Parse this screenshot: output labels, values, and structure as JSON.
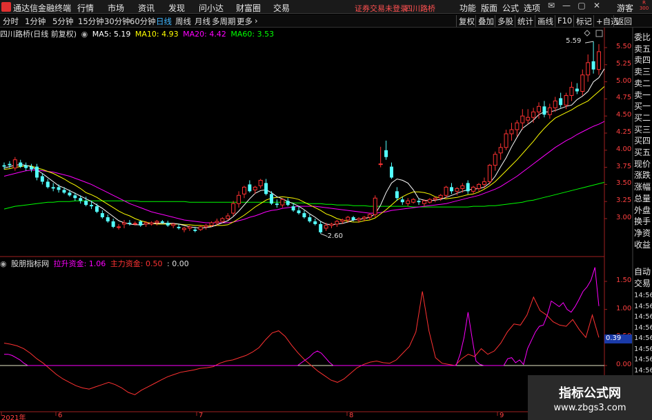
{
  "app": {
    "title": "通达信金融终端"
  },
  "menu": [
    "行情",
    "市场",
    "资讯",
    "发现",
    "问小达",
    "财富圈",
    "交易"
  ],
  "notice": "证券交易未登录",
  "stock_name_top": "四川路桥",
  "right_menu": [
    "功能",
    "版面",
    "公式",
    "选项"
  ],
  "guest": "游客",
  "badge_line1": "R",
  "badge_line2": "300",
  "periods": [
    {
      "label": "分时"
    },
    {
      "label": "1分钟"
    },
    {
      "label": "5分钟"
    },
    {
      "label": "15分钟"
    },
    {
      "label": "30分钟"
    },
    {
      "label": "60分钟"
    },
    {
      "label": "日线"
    },
    {
      "label": "周线"
    },
    {
      "label": "月线"
    },
    {
      "label": "多周期"
    },
    {
      "label": "更多"
    }
  ],
  "toolbar_right": [
    "复权",
    "叠加",
    "多股",
    "统计",
    "画线",
    "F10",
    "标记",
    "+自选",
    "返回"
  ],
  "main": {
    "title": "四川路桥(日线 前复权)",
    "ma5": "MA5: 5.19",
    "ma10": "MA10: 4.93",
    "ma20": "MA20: 4.42",
    "ma60": "MA60: 3.53",
    "high_label": "5.59",
    "low_label": "2.60",
    "y_ticks": [
      "5.50",
      "5.25",
      "5.00",
      "4.75",
      "4.50",
      "4.25",
      "4.00",
      "3.75",
      "3.50",
      "3.25",
      "3.00"
    ],
    "colors": {
      "ma5": "#ffffff",
      "ma10": "#ffff00",
      "ma20": "#ff00ff",
      "ma60": "#00ff00",
      "up": "#ff3232",
      "down": "#54ffff"
    }
  },
  "sub": {
    "title": "股朋指标网",
    "lashen": "拉升资金: 1.06",
    "zhuli": "主力资金: 0.50",
    "zero": ": 0.00",
    "y_ticks": [
      "1.50",
      "1.00",
      "0.50",
      "0.00"
    ],
    "cursor_value": "0.39"
  },
  "x_axis": [
    "2021年",
    "6",
    "7",
    "8",
    "9"
  ],
  "side_panel": [
    "委比",
    "卖五",
    "卖四",
    "卖三",
    "卖二",
    "卖一",
    "买一",
    "买二",
    "买三",
    "买四",
    "买五",
    "现价",
    "涨跌",
    "涨幅",
    "总量",
    "外盘",
    "换手",
    "净资",
    "收益"
  ],
  "side_panel2": [
    "自动",
    "交易"
  ],
  "side_times": [
    "14:56",
    "14:56",
    "14:56",
    "14:56",
    "14:56",
    "14:56",
    "14:56",
    "14:56"
  ],
  "watermark": {
    "title": "指标公式网",
    "url": "www.zbgs3.com"
  },
  "chart_data": {
    "type": "candlestick",
    "ohlc": [
      [
        3.78,
        3.82,
        3.72,
        3.76
      ],
      [
        3.8,
        3.84,
        3.74,
        3.78
      ],
      [
        3.74,
        3.9,
        3.7,
        3.86
      ],
      [
        3.82,
        3.86,
        3.74,
        3.76
      ],
      [
        3.78,
        3.82,
        3.7,
        3.74
      ],
      [
        3.76,
        3.8,
        3.68,
        3.72
      ],
      [
        3.76,
        3.8,
        3.56,
        3.6
      ],
      [
        3.62,
        3.66,
        3.5,
        3.54
      ],
      [
        3.54,
        3.58,
        3.44,
        3.46
      ],
      [
        3.46,
        3.52,
        3.4,
        3.44
      ],
      [
        3.46,
        3.5,
        3.38,
        3.42
      ],
      [
        3.42,
        3.46,
        3.36,
        3.38
      ],
      [
        3.38,
        3.42,
        3.32,
        3.34
      ],
      [
        3.34,
        3.38,
        3.26,
        3.3
      ],
      [
        3.3,
        3.34,
        3.22,
        3.26
      ],
      [
        3.26,
        3.32,
        3.18,
        3.2
      ],
      [
        3.2,
        3.26,
        3.14,
        3.18
      ],
      [
        3.18,
        3.22,
        3.08,
        3.1
      ],
      [
        3.08,
        3.12,
        3.0,
        3.02
      ],
      [
        3.02,
        3.06,
        2.94,
        2.96
      ],
      [
        2.96,
        3.0,
        2.86,
        2.88
      ],
      [
        2.88,
        2.92,
        2.84,
        2.88
      ],
      [
        2.92,
        2.98,
        2.86,
        2.94
      ],
      [
        2.94,
        2.98,
        2.9,
        2.92
      ],
      [
        2.92,
        2.96,
        2.9,
        2.93
      ],
      [
        2.96,
        2.98,
        2.88,
        2.9
      ],
      [
        2.92,
        2.96,
        2.88,
        2.94
      ],
      [
        2.92,
        2.96,
        2.9,
        2.94
      ],
      [
        2.94,
        2.98,
        2.9,
        2.96
      ],
      [
        2.96,
        2.98,
        2.92,
        2.94
      ],
      [
        2.94,
        2.97,
        2.88,
        2.9
      ],
      [
        2.9,
        2.94,
        2.86,
        2.92
      ],
      [
        2.88,
        2.92,
        2.84,
        2.86
      ],
      [
        2.84,
        2.88,
        2.8,
        2.86
      ],
      [
        2.86,
        2.9,
        2.82,
        2.88
      ],
      [
        2.84,
        2.88,
        2.8,
        2.82
      ],
      [
        2.84,
        2.9,
        2.82,
        2.88
      ],
      [
        2.88,
        2.92,
        2.84,
        2.9
      ],
      [
        2.9,
        2.96,
        2.88,
        2.94
      ],
      [
        2.94,
        3.0,
        2.9,
        2.96
      ],
      [
        2.96,
        3.02,
        2.94,
        3.0
      ],
      [
        3.0,
        3.08,
        2.98,
        3.04
      ],
      [
        3.08,
        3.26,
        3.04,
        3.22
      ],
      [
        3.22,
        3.4,
        3.16,
        3.34
      ],
      [
        3.36,
        3.48,
        3.3,
        3.46
      ],
      [
        3.5,
        3.56,
        3.38,
        3.4
      ],
      [
        3.42,
        3.48,
        3.36,
        3.46
      ],
      [
        3.48,
        3.58,
        3.44,
        3.56
      ],
      [
        3.52,
        3.58,
        3.34,
        3.36
      ],
      [
        3.36,
        3.4,
        3.2,
        3.22
      ],
      [
        3.22,
        3.28,
        3.16,
        3.2
      ],
      [
        3.2,
        3.3,
        3.16,
        3.28
      ],
      [
        3.26,
        3.3,
        3.18,
        3.2
      ],
      [
        3.18,
        3.22,
        3.1,
        3.12
      ],
      [
        3.12,
        3.18,
        3.06,
        3.08
      ],
      [
        3.08,
        3.12,
        3.0,
        3.02
      ],
      [
        3.02,
        3.06,
        2.94,
        2.96
      ],
      [
        2.96,
        3.0,
        2.9,
        2.92
      ],
      [
        2.92,
        2.96,
        2.78,
        2.8
      ],
      [
        2.86,
        2.94,
        2.82,
        2.9
      ],
      [
        2.9,
        2.94,
        2.86,
        2.92
      ],
      [
        2.92,
        2.98,
        2.88,
        2.96
      ],
      [
        2.96,
        3.0,
        2.92,
        2.98
      ],
      [
        2.98,
        3.04,
        2.94,
        3.02
      ],
      [
        3.02,
        3.04,
        2.96,
        2.98
      ],
      [
        2.98,
        3.02,
        2.94,
        3.0
      ],
      [
        3.0,
        3.04,
        2.96,
        3.02
      ],
      [
        3.02,
        3.08,
        2.98,
        3.06
      ],
      [
        3.06,
        3.34,
        3.02,
        3.3
      ],
      [
        3.8,
        4.05,
        3.75,
        3.8
      ],
      [
        4.0,
        4.14,
        3.86,
        3.9
      ],
      [
        3.76,
        3.82,
        3.58,
        3.6
      ],
      [
        3.4,
        3.46,
        3.26,
        3.3
      ],
      [
        3.28,
        3.32,
        3.2,
        3.24
      ],
      [
        3.22,
        3.3,
        3.18,
        3.26
      ],
      [
        3.24,
        3.3,
        3.22,
        3.28
      ],
      [
        3.26,
        3.3,
        3.2,
        3.24
      ],
      [
        3.22,
        3.28,
        3.18,
        3.26
      ],
      [
        3.24,
        3.3,
        3.22,
        3.28
      ],
      [
        3.28,
        3.32,
        3.24,
        3.3
      ],
      [
        3.3,
        3.36,
        3.26,
        3.34
      ],
      [
        3.34,
        3.48,
        3.3,
        3.46
      ],
      [
        3.46,
        3.52,
        3.36,
        3.4
      ],
      [
        3.4,
        3.46,
        3.34,
        3.44
      ],
      [
        3.44,
        3.52,
        3.38,
        3.48
      ],
      [
        3.52,
        3.56,
        3.36,
        3.4
      ],
      [
        3.4,
        3.48,
        3.36,
        3.46
      ],
      [
        3.44,
        3.52,
        3.4,
        3.5
      ],
      [
        3.5,
        3.6,
        3.44,
        3.54
      ],
      [
        3.54,
        3.8,
        3.5,
        3.78
      ],
      [
        3.78,
        3.98,
        3.7,
        3.94
      ],
      [
        3.96,
        4.1,
        3.86,
        4.04
      ],
      [
        4.04,
        4.3,
        4.0,
        4.24
      ],
      [
        4.24,
        4.4,
        4.14,
        4.3
      ],
      [
        4.3,
        4.44,
        4.2,
        4.4
      ],
      [
        4.4,
        4.6,
        4.3,
        4.5
      ],
      [
        4.44,
        4.6,
        4.38,
        4.48
      ],
      [
        4.48,
        4.62,
        4.4,
        4.56
      ],
      [
        4.56,
        4.7,
        4.46,
        4.64
      ],
      [
        4.64,
        4.72,
        4.48,
        4.52
      ],
      [
        4.52,
        4.68,
        4.46,
        4.62
      ],
      [
        4.62,
        4.78,
        4.56,
        4.72
      ],
      [
        4.76,
        4.84,
        4.62,
        4.66
      ],
      [
        4.66,
        4.84,
        4.6,
        4.8
      ],
      [
        4.8,
        5.0,
        4.72,
        4.92
      ],
      [
        4.9,
        4.98,
        4.82,
        4.86
      ],
      [
        4.86,
        5.18,
        4.8,
        5.1
      ],
      [
        5.1,
        5.4,
        5.0,
        5.28
      ],
      [
        5.3,
        5.59,
        5.12,
        5.18
      ],
      [
        5.18,
        5.55,
        5.1,
        5.44
      ]
    ],
    "ma5": [
      3.74,
      3.76,
      3.78,
      3.79,
      3.78,
      3.76,
      3.71,
      3.66,
      3.6,
      3.54,
      3.48,
      3.45,
      3.41,
      3.37,
      3.33,
      3.29,
      3.25,
      3.2,
      3.15,
      3.09,
      3.03,
      2.97,
      2.94,
      2.92,
      2.91,
      2.91,
      2.92,
      2.93,
      2.93,
      2.93,
      2.93,
      2.93,
      2.92,
      2.9,
      2.88,
      2.87,
      2.86,
      2.87,
      2.88,
      2.91,
      2.94,
      2.97,
      3.03,
      3.11,
      3.2,
      3.29,
      3.37,
      3.41,
      3.42,
      3.38,
      3.32,
      3.29,
      3.25,
      3.22,
      3.18,
      3.13,
      3.07,
      3.02,
      2.96,
      2.92,
      2.91,
      2.92,
      2.93,
      2.95,
      2.98,
      2.99,
      3.0,
      3.02,
      3.07,
      3.2,
      3.38,
      3.52,
      3.58,
      3.56,
      3.52,
      3.42,
      3.29,
      3.27,
      3.26,
      3.27,
      3.28,
      3.31,
      3.34,
      3.37,
      3.4,
      3.42,
      3.43,
      3.44,
      3.46,
      3.52,
      3.62,
      3.76,
      3.89,
      4.05,
      4.19,
      4.32,
      4.38,
      4.44,
      4.52,
      4.56,
      4.56,
      4.58,
      4.61,
      4.64,
      4.66,
      4.74,
      4.79,
      4.86,
      5.0,
      5.06,
      5.19
    ],
    "ma10": [
      3.72,
      3.73,
      3.75,
      3.76,
      3.77,
      3.77,
      3.74,
      3.72,
      3.69,
      3.66,
      3.62,
      3.58,
      3.53,
      3.49,
      3.44,
      3.38,
      3.35,
      3.31,
      3.26,
      3.21,
      3.16,
      3.11,
      3.07,
      3.04,
      3.0,
      2.97,
      2.95,
      2.93,
      2.92,
      2.92,
      2.92,
      2.92,
      2.92,
      2.91,
      2.91,
      2.9,
      2.9,
      2.89,
      2.89,
      2.9,
      2.9,
      2.91,
      2.95,
      3.0,
      3.05,
      3.11,
      3.17,
      3.22,
      3.27,
      3.3,
      3.31,
      3.32,
      3.31,
      3.3,
      3.28,
      3.24,
      3.2,
      3.16,
      3.12,
      3.07,
      3.04,
      3.0,
      2.98,
      2.96,
      2.95,
      2.95,
      2.97,
      2.98,
      3.01,
      3.07,
      3.13,
      3.2,
      3.27,
      3.32,
      3.36,
      3.39,
      3.39,
      3.38,
      3.36,
      3.32,
      3.3,
      3.29,
      3.3,
      3.31,
      3.33,
      3.35,
      3.36,
      3.39,
      3.43,
      3.48,
      3.54,
      3.62,
      3.7,
      3.78,
      3.86,
      3.95,
      4.04,
      4.13,
      4.23,
      4.32,
      4.4,
      4.47,
      4.51,
      4.55,
      4.59,
      4.64,
      4.68,
      4.72,
      4.79,
      4.86,
      4.93
    ],
    "ma20": [
      3.62,
      3.64,
      3.66,
      3.68,
      3.7,
      3.71,
      3.71,
      3.7,
      3.69,
      3.68,
      3.66,
      3.64,
      3.62,
      3.59,
      3.56,
      3.53,
      3.5,
      3.46,
      3.42,
      3.38,
      3.34,
      3.3,
      3.26,
      3.22,
      3.19,
      3.16,
      3.13,
      3.1,
      3.08,
      3.06,
      3.04,
      3.02,
      3.0,
      2.98,
      2.97,
      2.96,
      2.95,
      2.94,
      2.94,
      2.94,
      2.94,
      2.94,
      2.95,
      2.97,
      2.99,
      3.02,
      3.04,
      3.07,
      3.1,
      3.12,
      3.13,
      3.15,
      3.16,
      3.17,
      3.18,
      3.18,
      3.18,
      3.18,
      3.17,
      3.16,
      3.15,
      3.14,
      3.13,
      3.12,
      3.11,
      3.1,
      3.09,
      3.08,
      3.08,
      3.09,
      3.1,
      3.12,
      3.13,
      3.14,
      3.15,
      3.16,
      3.17,
      3.18,
      3.19,
      3.2,
      3.21,
      3.22,
      3.24,
      3.26,
      3.28,
      3.3,
      3.32,
      3.34,
      3.37,
      3.4,
      3.43,
      3.47,
      3.52,
      3.57,
      3.62,
      3.68,
      3.74,
      3.8,
      3.86,
      3.92,
      3.98,
      4.04,
      4.09,
      4.14,
      4.18,
      4.23,
      4.27,
      4.31,
      4.35,
      4.38,
      4.42
    ],
    "ma60": [
      3.14,
      3.16,
      3.18,
      3.19,
      3.2,
      3.21,
      3.22,
      3.23,
      3.24,
      3.24,
      3.25,
      3.25,
      3.25,
      3.26,
      3.26,
      3.26,
      3.26,
      3.26,
      3.26,
      3.26,
      3.26,
      3.26,
      3.26,
      3.26,
      3.26,
      3.25,
      3.25,
      3.25,
      3.25,
      3.25,
      3.25,
      3.25,
      3.25,
      3.25,
      3.24,
      3.24,
      3.24,
      3.24,
      3.24,
      3.24,
      3.24,
      3.24,
      3.24,
      3.24,
      3.24,
      3.24,
      3.24,
      3.24,
      3.24,
      3.24,
      3.24,
      3.24,
      3.24,
      3.23,
      3.23,
      3.23,
      3.22,
      3.22,
      3.22,
      3.21,
      3.21,
      3.2,
      3.2,
      3.2,
      3.19,
      3.19,
      3.19,
      3.18,
      3.18,
      3.18,
      3.18,
      3.18,
      3.18,
      3.18,
      3.18,
      3.17,
      3.17,
      3.17,
      3.17,
      3.17,
      3.17,
      3.17,
      3.17,
      3.17,
      3.17,
      3.17,
      3.18,
      3.18,
      3.18,
      3.19,
      3.19,
      3.2,
      3.21,
      3.22,
      3.23,
      3.24,
      3.26,
      3.27,
      3.29,
      3.31,
      3.33,
      3.35,
      3.37,
      3.39,
      3.41,
      3.43,
      3.45,
      3.47,
      3.49,
      3.51,
      3.53
    ],
    "lashen": [
      0.2,
      0.2,
      0.18,
      0.14,
      0.1,
      0.04,
      0,
      0,
      0,
      0,
      0,
      0,
      0,
      0,
      0,
      0,
      0,
      0,
      0,
      0,
      0,
      0,
      0,
      0,
      0,
      0,
      0,
      0,
      0,
      0,
      0,
      0,
      0,
      0,
      0,
      0,
      0,
      0,
      0,
      0,
      0,
      0,
      0,
      0,
      0,
      0,
      0,
      0,
      0,
      0,
      0,
      0,
      0,
      0,
      0,
      0,
      0,
      0,
      0,
      0,
      0,
      0,
      0,
      0,
      0,
      0,
      0,
      0,
      0,
      0,
      0,
      0,
      0,
      0,
      0,
      0.05,
      0.1,
      0.15,
      0.22,
      0.26,
      0.22,
      0.14,
      0.06,
      0,
      0,
      0,
      0,
      0,
      0,
      0,
      0,
      0,
      0,
      0,
      0,
      0,
      0,
      0,
      0,
      0,
      0,
      0,
      0,
      0,
      0,
      0,
      0,
      0,
      0,
      0,
      0,
      0,
      0,
      0,
      0,
      0.2,
      0.5,
      0.95,
      0.5,
      0.08,
      0.02,
      0,
      0,
      0,
      0,
      0,
      0,
      0.12,
      0.14,
      0.05,
      0.1,
      0.02,
      0.3,
      0.45,
      0.6,
      0.7,
      0.72,
      0.9,
      1.15,
      1.1,
      1.05,
      1.12,
      1.0,
      0.95,
      1.05,
      1.18,
      1.32,
      1.4,
      1.52,
      1.75,
      1.06
    ],
    "zhuli": [
      0.4,
      0.38,
      0.35,
      0.3,
      0.22,
      0.12,
      0.04,
      -0.06,
      -0.16,
      -0.24,
      -0.3,
      -0.36,
      -0.4,
      -0.42,
      -0.38,
      -0.34,
      -0.3,
      -0.34,
      -0.4,
      -0.48,
      -0.52,
      -0.44,
      -0.38,
      -0.32,
      -0.26,
      -0.2,
      -0.16,
      -0.12,
      -0.1,
      -0.08,
      -0.05,
      -0.04,
      -0.02,
      0.04,
      0.08,
      0.1,
      0.14,
      0.18,
      0.24,
      0.32,
      0.46,
      0.58,
      0.62,
      0.52,
      0.36,
      0.22,
      0.1,
      0,
      -0.1,
      -0.18,
      -0.26,
      -0.3,
      -0.24,
      -0.14,
      -0.04,
      0.02,
      0.06,
      0.08,
      0.05,
      0.04,
      0.1,
      0.22,
      0.34,
      0.6,
      1.32,
      0.62,
      0.14,
      0.04,
      0.02,
      0,
      0.12,
      0.2,
      0.16,
      0.3,
      0.2,
      0.26,
      0.4,
      0.6,
      0.74,
      0.72,
      0.9,
      1.22,
      0.98,
      0.9,
      0.78,
      0.72,
      0.7,
      0.82,
      0.64,
      0.5,
      0.9,
      0.5
    ]
  }
}
